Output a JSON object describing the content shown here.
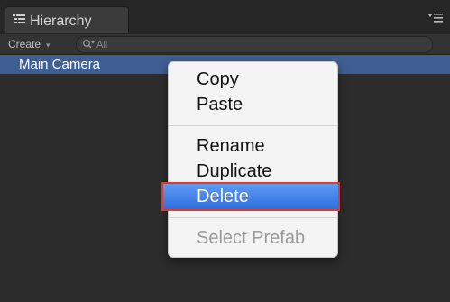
{
  "panel": {
    "tab_label": "Hierarchy",
    "tab_icon": "list-icon",
    "tab_menu_icon": "panel-menu-icon"
  },
  "toolbar": {
    "create_label": "Create",
    "create_arrow": "▾",
    "search_placeholder": "All",
    "search_icon": "search-icon"
  },
  "hierarchy": {
    "items": [
      {
        "label": "Main Camera",
        "selected": true
      }
    ]
  },
  "context_menu": {
    "items": [
      {
        "label": "Copy",
        "enabled": true
      },
      {
        "label": "Paste",
        "enabled": true
      },
      {
        "label": "Rename",
        "enabled": true
      },
      {
        "label": "Duplicate",
        "enabled": true
      },
      {
        "label": "Delete",
        "enabled": true,
        "highlighted": true
      },
      {
        "label": "Select Prefab",
        "enabled": false
      }
    ]
  },
  "colors": {
    "background": "#2c2c2c",
    "selection": "#3f5f93",
    "menu_highlight": "#3a7ce9",
    "highlight_outline": "#dd3b2e"
  }
}
